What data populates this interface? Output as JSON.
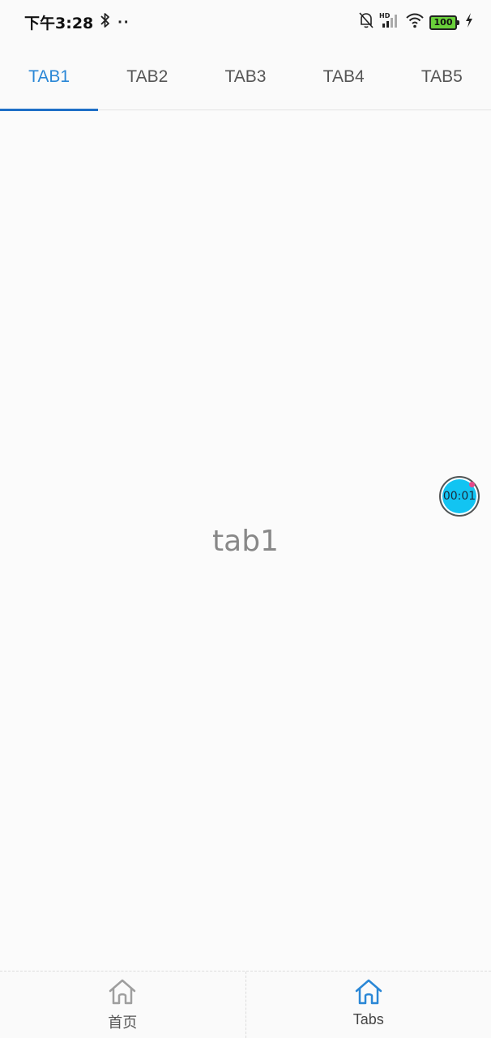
{
  "status_bar": {
    "time": "下午3:28",
    "dots": "··",
    "battery": "100",
    "icons": [
      "bluetooth-icon",
      "mute-bell-icon",
      "hd-signal-icon",
      "wifi-icon",
      "battery-icon",
      "charging-icon"
    ]
  },
  "tabs": [
    {
      "label": "TAB1",
      "active": true
    },
    {
      "label": "TAB2",
      "active": false
    },
    {
      "label": "TAB3",
      "active": false
    },
    {
      "label": "TAB4",
      "active": false
    },
    {
      "label": "TAB5",
      "active": false
    }
  ],
  "content": {
    "title": "tab1",
    "timer": "00:01"
  },
  "bottom_nav": [
    {
      "label": "首页",
      "icon": "home-icon",
      "active": false
    },
    {
      "label": "Tabs",
      "icon": "home-icon",
      "active": true
    }
  ],
  "colors": {
    "accent": "#2a87d6",
    "indicator": "#1e6fc7",
    "timer": "#12c4f2",
    "inactive_icon": "#9e9e9e"
  }
}
